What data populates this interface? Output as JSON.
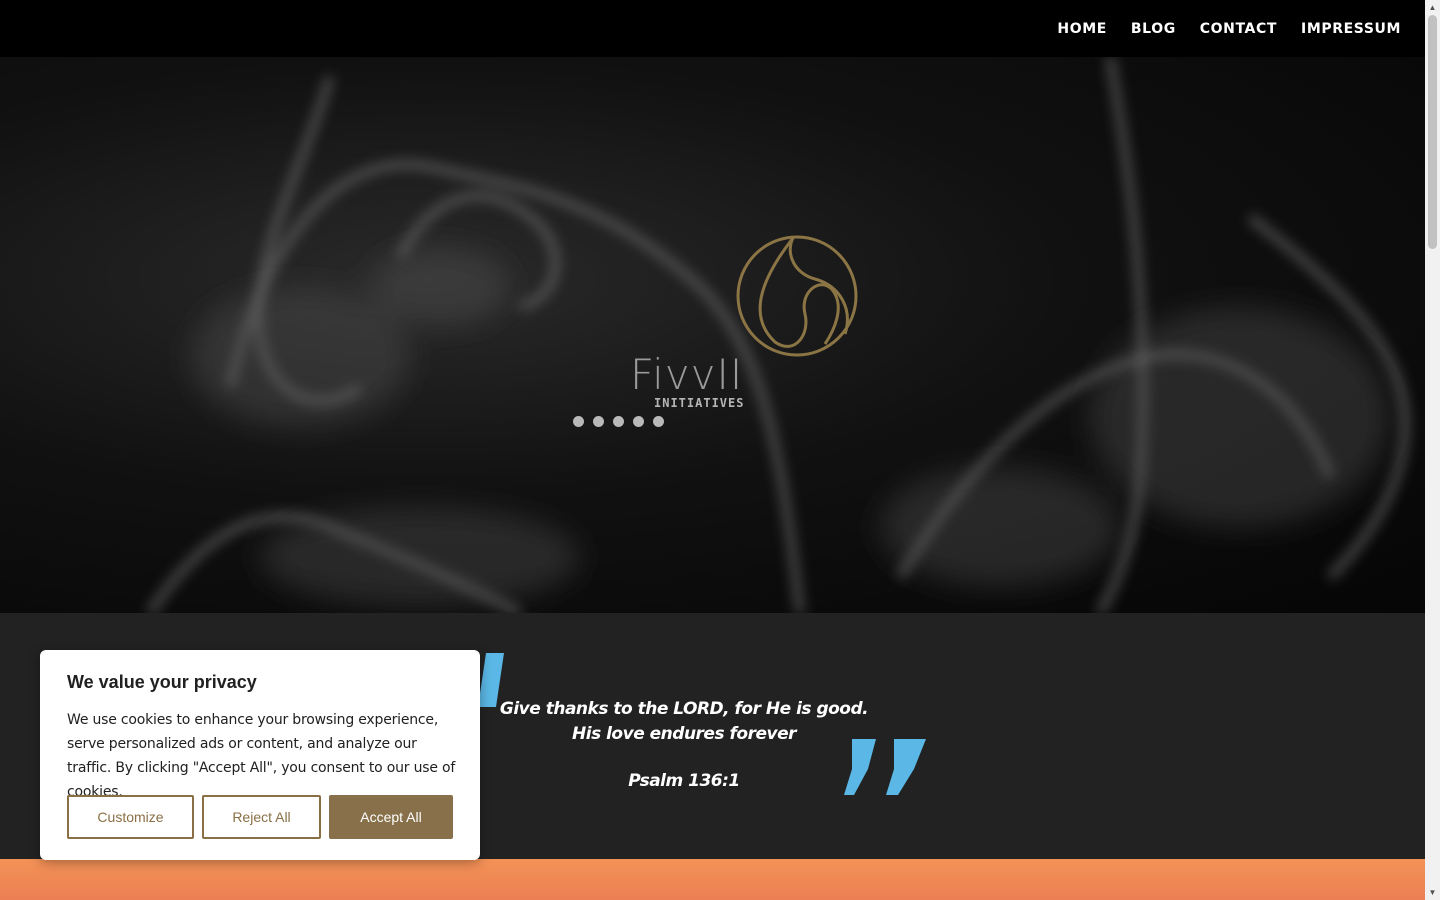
{
  "nav": {
    "items": [
      {
        "label": "HOME"
      },
      {
        "label": "BLOG"
      },
      {
        "label": "CONTACT"
      },
      {
        "label": "IMPRESSUM"
      }
    ]
  },
  "hero": {
    "logo_name": "FivvII",
    "logo_sub": "INITIATIVES",
    "logo_color": "#8b7545",
    "slider_dots": 5
  },
  "quote": {
    "line1": "Give thanks to the LORD, for He is good.",
    "line2": "His love endures forever",
    "citation": "Psalm 136:1",
    "accent_color": "#5bb7e5"
  },
  "cookie_banner": {
    "title": "We value your privacy",
    "body": "We use cookies to enhance your browsing experience, serve personalized ads or content, and analyze our traffic. By clicking \"Accept All\", you consent to our use of cookies.",
    "customize_label": "Customize",
    "reject_label": "Reject All",
    "accept_label": "Accept All",
    "brand_color": "#87704a"
  }
}
